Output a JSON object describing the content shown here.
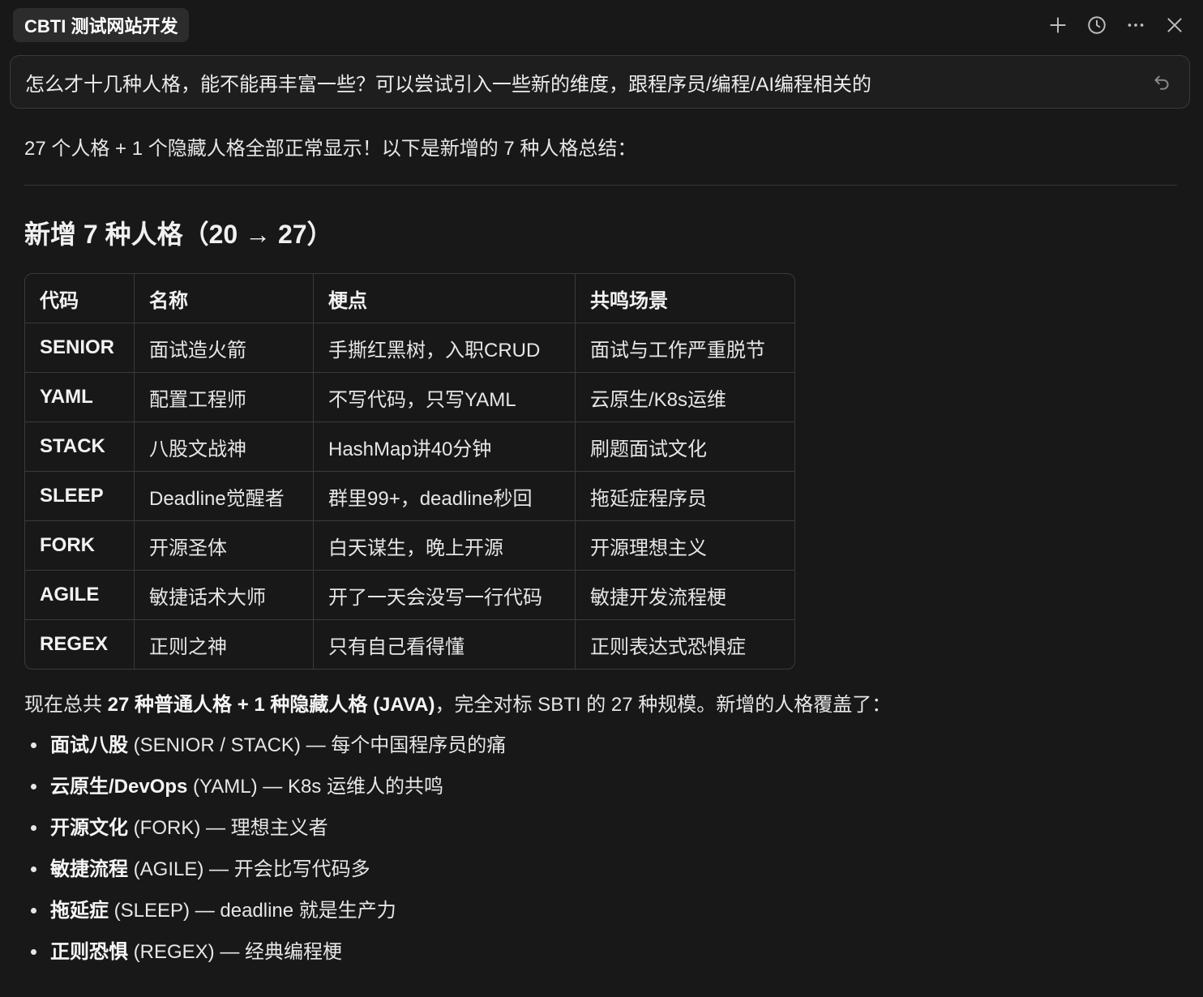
{
  "window": {
    "tab_title": "CBTI 测试网站开发"
  },
  "prompt": {
    "text": "怎么才十几种人格，能不能再丰富一些？可以尝试引入一些新的维度，跟程序员/编程/AI编程相关的"
  },
  "message": {
    "intro": "27 个人格 + 1 个隐藏人格全部正常显示！以下是新增的 7 种人格总结：",
    "heading": "新增 7 种人格（20 → 27）",
    "table": {
      "headers": [
        "代码",
        "名称",
        "梗点",
        "共鸣场景"
      ],
      "rows": [
        [
          "SENIOR",
          "面试造火箭",
          "手撕红黑树，入职CRUD",
          "面试与工作严重脱节"
        ],
        [
          "YAML",
          "配置工程师",
          "不写代码，只写YAML",
          "云原生/K8s运维"
        ],
        [
          "STACK",
          "八股文战神",
          "HashMap讲40分钟",
          "刷题面试文化"
        ],
        [
          "SLEEP",
          "Deadline觉醒者",
          "群里99+，deadline秒回",
          "拖延症程序员"
        ],
        [
          "FORK",
          "开源圣体",
          "白天谋生，晚上开源",
          "开源理想主义"
        ],
        [
          "AGILE",
          "敏捷话术大师",
          "开了一天会没写一行代码",
          "敏捷开发流程梗"
        ],
        [
          "REGEX",
          "正则之神",
          "只有自己看得懂",
          "正则表达式恐惧症"
        ]
      ]
    },
    "summary": {
      "prefix": "现在总共 ",
      "bold": "27 种普通人格 + 1 种隐藏人格 (JAVA)",
      "suffix": "，完全对标 SBTI 的 27 种规模。新增的人格覆盖了："
    },
    "features": [
      {
        "bold": "面试八股",
        "rest": " (SENIOR / STACK) — 每个中国程序员的痛"
      },
      {
        "bold": "云原生/DevOps",
        "rest": " (YAML) — K8s 运维人的共鸣"
      },
      {
        "bold": "开源文化",
        "rest": " (FORK) — 理想主义者"
      },
      {
        "bold": "敏捷流程",
        "rest": " (AGILE) — 开会比写代码多"
      },
      {
        "bold": "拖延症",
        "rest": " (SLEEP) — deadline 就是生产力"
      },
      {
        "bold": "正则恐惧",
        "rest": " (REGEX) — 经典编程梗"
      }
    ]
  }
}
